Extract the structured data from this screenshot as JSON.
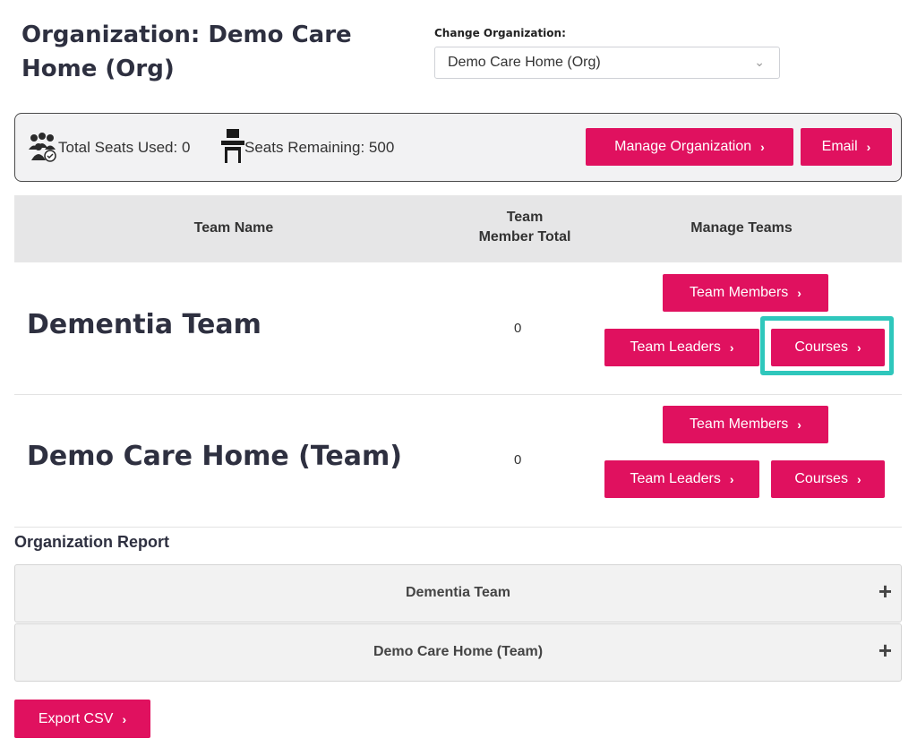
{
  "header": {
    "org_title": "Organization: Demo Care Home (Org)",
    "change_label": "Change Organization:",
    "selected_org": "Demo Care Home (Org)"
  },
  "seats": {
    "used_label": "Total Seats Used: 0",
    "remaining_label": "Seats Remaining: 500",
    "manage_org_button": "Manage Organization",
    "email_button": "Email"
  },
  "table": {
    "headers": [
      "Team Name",
      "Team\nMember Total",
      "Manage Teams"
    ],
    "rows": [
      {
        "name": "Dementia Team",
        "total": "0",
        "team_members": "Team Members",
        "team_leaders": "Team Leaders",
        "courses": "Courses"
      },
      {
        "name": "Demo Care Home (Team)",
        "total": "0",
        "team_members": "Team Members",
        "team_leaders": "Team Leaders",
        "courses": "Courses"
      }
    ]
  },
  "report": {
    "title": "Organization Report",
    "items": [
      "Dementia Team",
      "Demo Care Home (Team)"
    ],
    "export_button": "Export CSV"
  },
  "colors": {
    "accent": "#e0115f",
    "highlight": "#2fc7bc",
    "header_bg": "#e6e6e7"
  },
  "icons": {
    "arrow": "›",
    "plus": "+",
    "chevron": "⌄"
  }
}
